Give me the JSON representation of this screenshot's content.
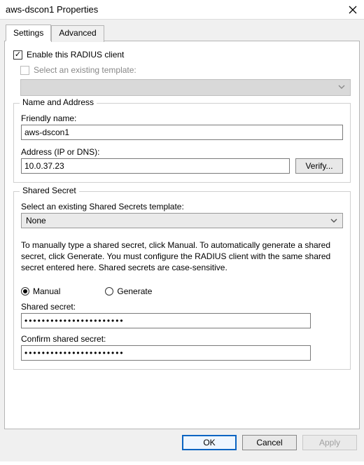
{
  "window": {
    "title": "aws-dscon1 Properties"
  },
  "tabs": {
    "settings": "Settings",
    "advanced": "Advanced"
  },
  "enable_client_label": "Enable this RADIUS client",
  "select_template_label": "Select an existing template:",
  "name_address": {
    "legend": "Name and Address",
    "friendly_name_label": "Friendly name:",
    "friendly_name_value": "aws-dscon1",
    "address_label": "Address (IP or DNS):",
    "address_value": "10.0.37.23",
    "verify_label": "Verify..."
  },
  "shared_secret": {
    "legend": "Shared Secret",
    "template_label": "Select an existing Shared Secrets template:",
    "template_value": "None",
    "instructions": "To manually type a shared secret, click Manual. To automatically generate a shared secret, click Generate. You must configure the RADIUS client with the same shared secret entered here. Shared secrets are case-sensitive.",
    "radio_manual": "Manual",
    "radio_generate": "Generate",
    "secret_label": "Shared secret:",
    "secret_value": "•••••••••••••••••••••••",
    "confirm_label": "Confirm shared secret:",
    "confirm_value": "•••••••••••••••••••••••"
  },
  "buttons": {
    "ok": "OK",
    "cancel": "Cancel",
    "apply": "Apply"
  }
}
